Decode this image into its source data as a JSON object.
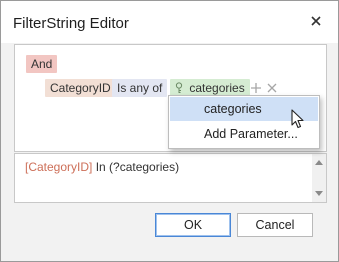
{
  "window": {
    "title": "FilterString Editor"
  },
  "builder": {
    "group_operator": "And",
    "condition": {
      "field": "CategoryID",
      "operator": "Is any of",
      "parameter": "categories"
    }
  },
  "dropdown": {
    "items": [
      {
        "label": "categories",
        "selected": true
      },
      {
        "label": "Add Parameter...",
        "selected": false
      }
    ]
  },
  "expression": {
    "field": "[CategoryID]",
    "rest": " In (?categories)"
  },
  "buttons": {
    "ok": "OK",
    "cancel": "Cancel"
  },
  "icons": {
    "close": "close-icon",
    "parameter": "parameter-icon",
    "add": "add-condition-icon",
    "remove": "remove-condition-icon",
    "cursor": "mouse-cursor-icon"
  },
  "colors": {
    "group_chip": "#f2c6c2",
    "field_chip": "#f2dfd5",
    "operator_chip": "#e3e6f2",
    "parameter_chip": "#d5ecd2",
    "selected_item": "#cfe0f6",
    "expression_field": "#cd6f58",
    "ok_border": "#4a87d6"
  }
}
